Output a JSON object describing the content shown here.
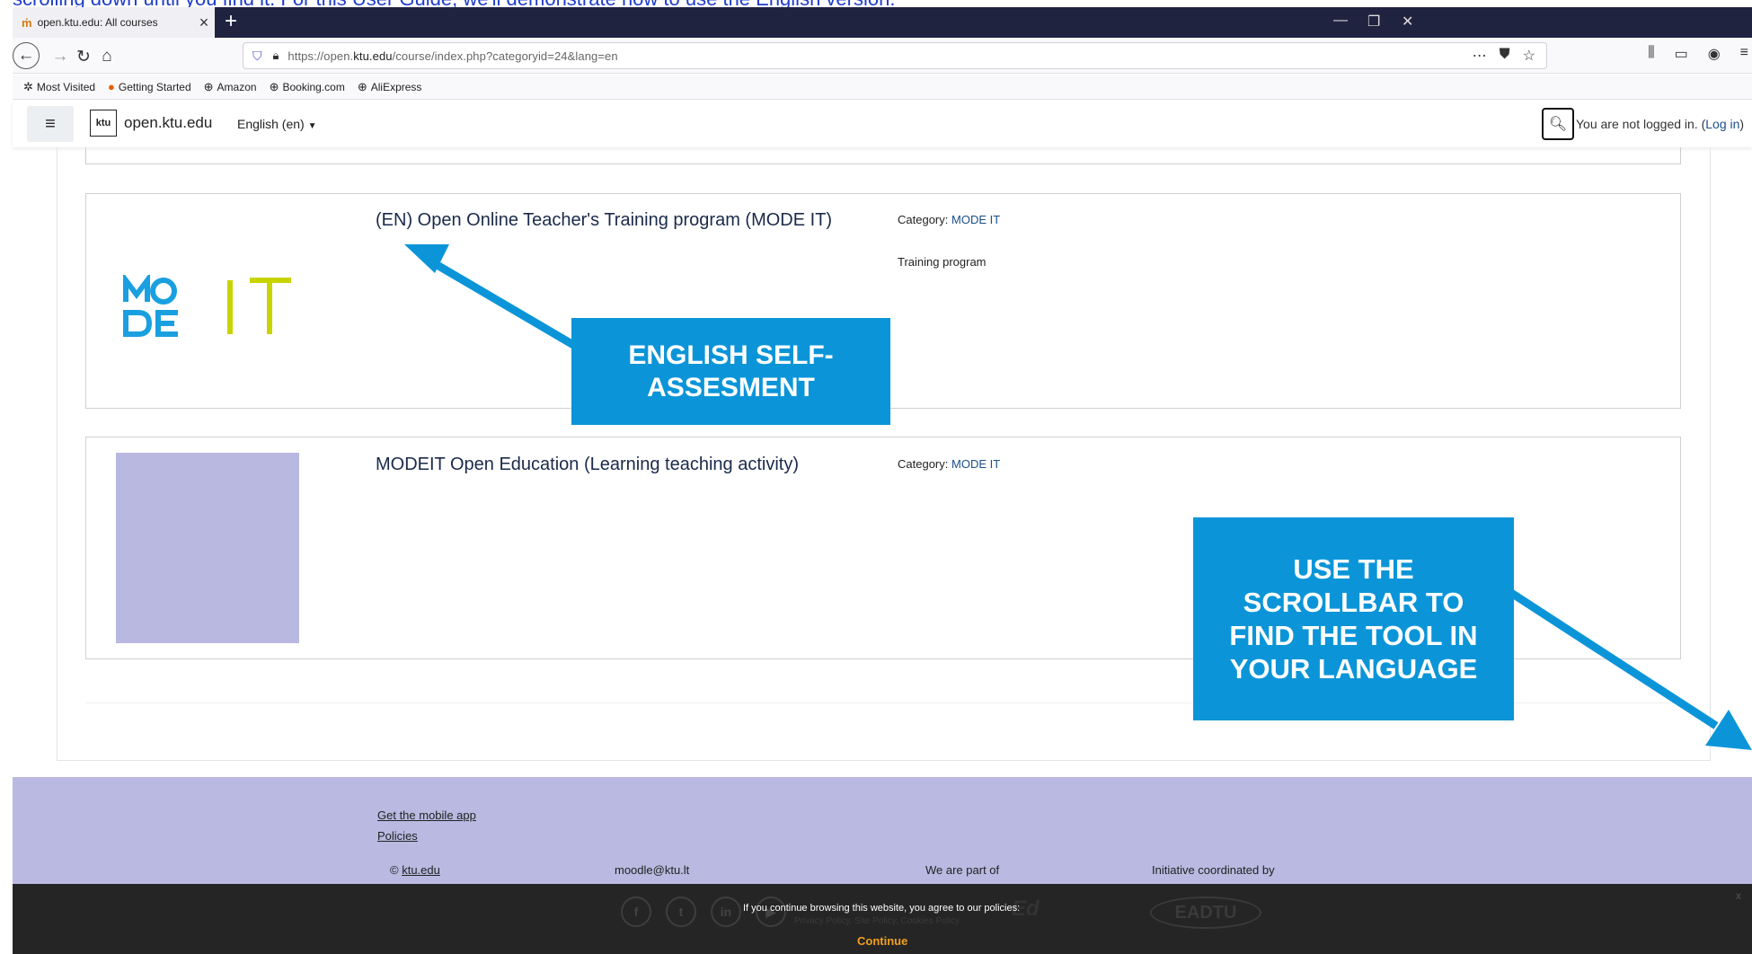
{
  "doc_text": "scrolling down until you find it. For this User Guide, we'll demonstrate how to use the English version.",
  "browser": {
    "tab_title": "open.ktu.edu: All courses",
    "url_prefix": "https://open.",
    "url_domain": "ktu.edu",
    "url_path": "/course/index.php?categoryid=24&lang=en",
    "bookmarks": [
      "Most Visited",
      "Getting Started",
      "Amazon",
      "Booking.com",
      "AliExpress"
    ]
  },
  "header": {
    "logo_text": "ktu",
    "site_name": "open.ktu.edu",
    "language": "English (en)",
    "login_text": "You are not logged in. (",
    "login_link": "Log in",
    "login_close": ")"
  },
  "courses": [
    {
      "title": "(EN) Open Online Teacher's Training program (MODE IT)",
      "category_label": "Category:",
      "category": "MODE IT",
      "summary": "Training program"
    },
    {
      "title": "MODEIT Open Education (Learning teaching activity)",
      "category_label": "Category:",
      "category": "MODE IT"
    }
  ],
  "footer": {
    "mobile_app": "Get the mobile app",
    "policies": "Policies",
    "copyright_symbol": "©",
    "copyright_link": "ktu.edu",
    "email": "moodle@ktu.lt",
    "part_of": "We are part of",
    "coordinated": "Initiative coordinated by",
    "eadtu": "EADTU",
    "openupped": "Ed"
  },
  "cookie": {
    "message": "If you continue browsing this website, you agree to our policies:",
    "links": "Privacy Policy, Site Policy, Cookies Policy",
    "continue": "Continue",
    "close": "x"
  },
  "callouts": {
    "english": "ENGLISH SELF-ASSESMENT",
    "scrollbar": "USE THE SCROLLBAR TO FIND THE TOOL IN YOUR LANGUAGE"
  },
  "colors": {
    "callout": "#0b95d8",
    "footer": "#b9b9e1",
    "mode_blue": "#1aa0e0",
    "mode_yellow": "#c8d400"
  }
}
